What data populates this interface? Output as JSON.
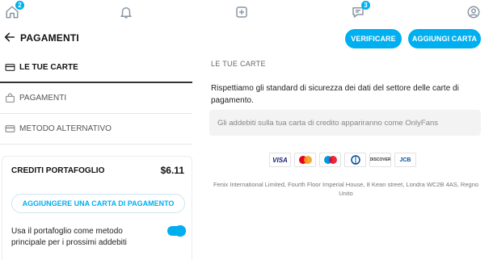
{
  "nav": {
    "home_badge": "2",
    "messages_badge": "3"
  },
  "header": {
    "title": "PAGAMENTI",
    "verify_label": "VERIFICARE",
    "add_card_label": "AGGIUNGI CARTA"
  },
  "menu": {
    "items": [
      {
        "label": "LE TUE CARTE",
        "icon": "card-icon",
        "active": true
      },
      {
        "label": "PAGAMENTI",
        "icon": "bag-icon",
        "active": false
      },
      {
        "label": "METODO ALTERNATIVO",
        "icon": "card-icon",
        "active": false
      }
    ]
  },
  "wallet": {
    "title": "CREDITI PORTAFOGLIO",
    "amount": "$6.11",
    "add_card_button": "AGGIUNGERE UNA CARTA DI PAGAMENTO",
    "primary_text": "Usa il portafoglio come metodo principale per i prossimi addebiti",
    "primary_enabled": true
  },
  "content": {
    "section_title": "LE TUE CARTE",
    "security_text": "Rispettiamo gli standard di sicurezza dei dati del settore delle carte di pagamento.",
    "charges_note": "Gli addebiti sulla tua carta di credito appariranno come OnlyFans",
    "card_logos": [
      {
        "name": "visa-logo",
        "text": "VISA",
        "color": "#1a1f71"
      },
      {
        "name": "mastercard-logo",
        "text": "",
        "color": "#eb001b"
      },
      {
        "name": "maestro-logo",
        "text": "",
        "color": "#0099df"
      },
      {
        "name": "diners-logo",
        "text": "",
        "color": "#004a97"
      },
      {
        "name": "discover-logo",
        "text": "DISCOVER",
        "color": "#f48120"
      },
      {
        "name": "jcb-logo",
        "text": "JCB",
        "color": "#0b4ea2"
      }
    ],
    "address": "Fenix International Limited, Fourth Floor Imperial House, 8 Kean street, Londra WC2B 4AS, Regno Unito"
  },
  "colors": {
    "accent": "#00aff0"
  }
}
